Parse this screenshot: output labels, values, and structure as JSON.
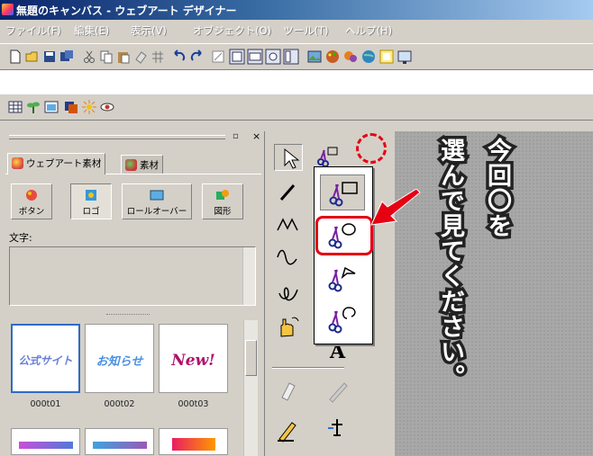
{
  "window": {
    "title": "無題のキャンバス - ウェブアート デザイナー"
  },
  "menu": [
    "ファイル(F)",
    "編集(E)",
    "表示(V)",
    "オブジェクト(O)",
    "ツール(T)",
    "ヘルプ(H)"
  ],
  "panel": {
    "tabs": [
      "ウェブアート素材",
      "素材"
    ],
    "categories": [
      "ボタン",
      "ロゴ",
      "ロールオーバー",
      "図形"
    ],
    "text_label": "文字:",
    "thumbnails": [
      {
        "label": "000t01",
        "text": "公式サイト"
      },
      {
        "label": "000t02",
        "text": "お知らせ"
      },
      {
        "label": "000t03",
        "text": "New!"
      }
    ]
  },
  "annotation": {
    "line1": "今回〇を",
    "line2": "選んで見てください。"
  },
  "colors": {
    "accent": "#e60012",
    "title_gradient_start": "#0a246a",
    "title_gradient_end": "#a6caf0",
    "face": "#d4d0c8",
    "canvas": "#a8a8a8"
  },
  "icons": {
    "selection": "pointer-arrow-icon",
    "clip_rect": "clip-rectangle-icon",
    "clip_ellipse": "clip-ellipse-icon",
    "clip_polygon": "clip-polygon-icon",
    "clip_freehand": "clip-freehand-icon",
    "line": "line-tool-icon",
    "polyline": "polyline-tool-icon",
    "curve": "curve-tool-icon",
    "freehand": "freehand-tool-icon",
    "text": "text-tool-icon",
    "hand": "hand-tool-icon"
  }
}
